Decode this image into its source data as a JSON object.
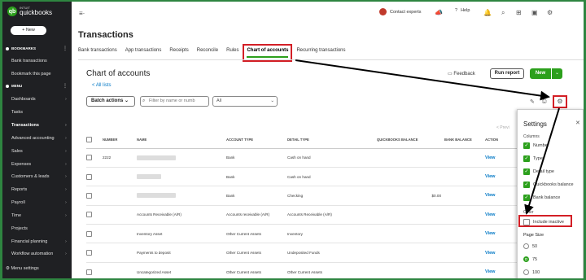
{
  "brand": {
    "intuit": "INTUIT",
    "name": "quickbooks",
    "new_label": "+ New"
  },
  "sidebar": {
    "bookmarks_header": "BOOKMARKS",
    "bookmark_items": [
      "Bank transactions",
      "Bookmark this page"
    ],
    "menu_header": "MENU",
    "items": [
      {
        "label": "Dashboards"
      },
      {
        "label": "Tasks"
      },
      {
        "label": "Transactions"
      },
      {
        "label": "Advanced accounting"
      },
      {
        "label": "Sales"
      },
      {
        "label": "Expenses"
      },
      {
        "label": "Customers & leads"
      },
      {
        "label": "Reports"
      },
      {
        "label": "Payroll"
      },
      {
        "label": "Time"
      },
      {
        "label": "Projects"
      },
      {
        "label": "Financial planning"
      },
      {
        "label": "Workflow automation"
      }
    ],
    "footer": "Menu settings"
  },
  "topbar": {
    "contact": "Contact experts",
    "help": "Help"
  },
  "page": {
    "title": "Transactions",
    "tabs": [
      "Bank transactions",
      "App transactions",
      "Receipts",
      "Reconcile",
      "Rules",
      "Chart of accounts",
      "Recurring transactions"
    ],
    "heading": "Chart of accounts",
    "all_lists": "< All lists",
    "feedback": "Feedback",
    "run_report": "Run report",
    "new": "New",
    "batch_actions": "Batch actions",
    "filter_placeholder": "Filter by name or numb",
    "all_select": "All",
    "prev": "< Previ"
  },
  "table": {
    "headers": [
      "NUMBER",
      "NAME",
      "ACCOUNT TYPE",
      "DETAIL TYPE",
      "QUICKBOOKS BALANCE",
      "BANK BALANCE",
      "ACTION"
    ],
    "rows": [
      {
        "number": "2222",
        "name": "",
        "type": "Bank",
        "detail": "Cash on hand",
        "qb": "",
        "bank": "",
        "action": "View"
      },
      {
        "number": "",
        "name": "",
        "type": "Bank",
        "detail": "Cash on hand",
        "qb": "",
        "bank": "",
        "action": "View"
      },
      {
        "number": "",
        "name": "",
        "type": "Bank",
        "detail": "Checking",
        "qb": "$0.00",
        "bank": "",
        "action": "View"
      },
      {
        "number": "",
        "name": "Accounts Receivable (A/R)",
        "type": "Accounts receivable (A/R)",
        "detail": "Accounts Receivable (A/R)",
        "qb": "",
        "bank": "",
        "action": "View"
      },
      {
        "number": "",
        "name": "Inventory Asset",
        "type": "Other Current Assets",
        "detail": "Inventory",
        "qb": "",
        "bank": "",
        "action": "View"
      },
      {
        "number": "",
        "name": "Payments to deposit",
        "type": "Other Current Assets",
        "detail": "Undeposited Funds",
        "qb": "",
        "bank": "",
        "action": "View"
      },
      {
        "number": "",
        "name": "Uncategorized Asset",
        "type": "Other Current Assets",
        "detail": "Other Current Assets",
        "qb": "",
        "bank": "",
        "action": "View"
      }
    ]
  },
  "settings": {
    "title": "Settings",
    "columns_label": "Columns",
    "columns": [
      {
        "label": "Number",
        "checked": true
      },
      {
        "label": "Type",
        "checked": true
      },
      {
        "label": "Detail type",
        "checked": true
      },
      {
        "label": "Quickbooks balance",
        "checked": true
      },
      {
        "label": "Bank balance",
        "checked": true
      }
    ],
    "other_label": "Other",
    "include_inactive": "Include inactive",
    "page_size_label": "Page Size",
    "page_sizes": [
      "50",
      "75",
      "100"
    ],
    "selected_page_size": "75"
  },
  "colors": {
    "accent": "#2ca01c",
    "highlight": "#d31f26",
    "sidebar": "#1f2023"
  }
}
